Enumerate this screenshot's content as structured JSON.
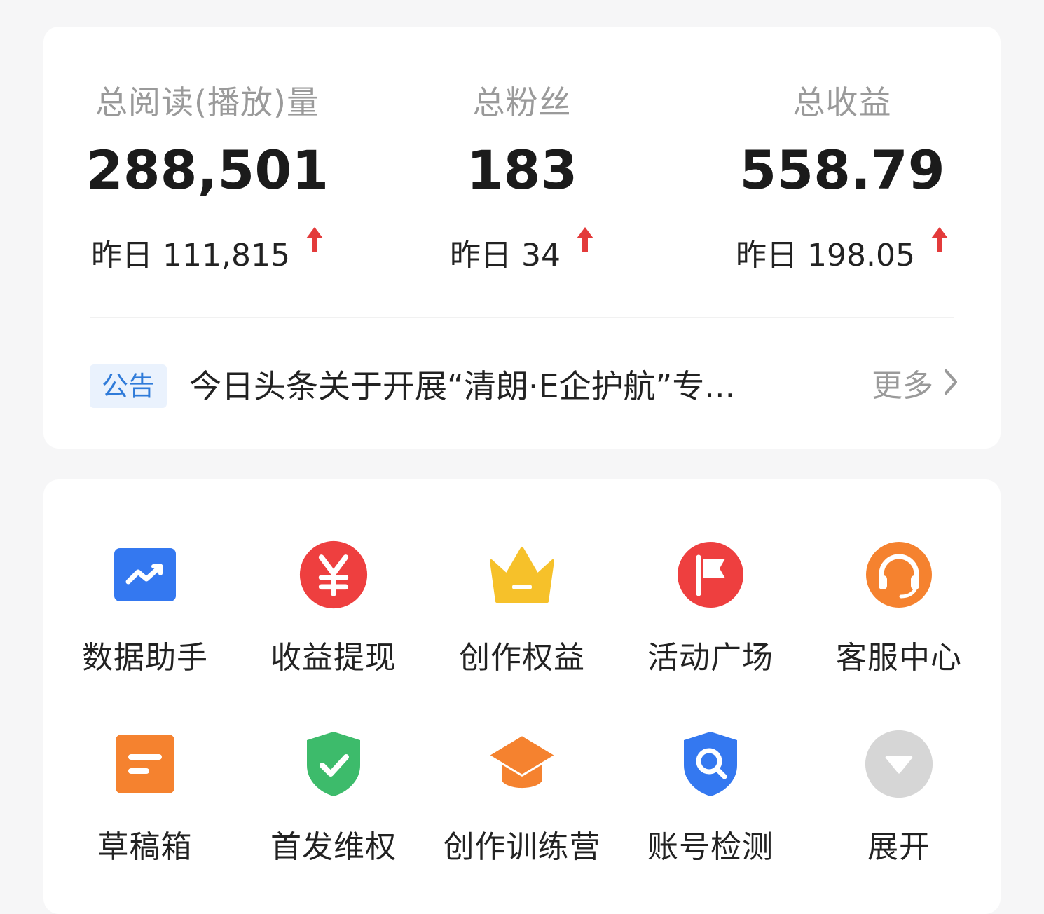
{
  "stats": [
    {
      "label": "总阅读(播放)量",
      "value": "288,501",
      "yesterday": "昨日 111,815"
    },
    {
      "label": "总粉丝",
      "value": "183",
      "yesterday": "昨日 34"
    },
    {
      "label": "总收益",
      "value": "558.79",
      "yesterday": "昨日 198.05"
    }
  ],
  "notice": {
    "badge": "公告",
    "text": "今日头条关于开展“清朗·E企护航”专...",
    "more": "更多"
  },
  "tools": [
    {
      "label": "数据助手",
      "icon": "chart-icon",
      "color": "#3478f0"
    },
    {
      "label": "收益提现",
      "icon": "yuan-icon",
      "color": "#ee3f3f"
    },
    {
      "label": "创作权益",
      "icon": "crown-icon",
      "color": "#f6c12a"
    },
    {
      "label": "活动广场",
      "icon": "flag-icon",
      "color": "#ee3f3f"
    },
    {
      "label": "客服中心",
      "icon": "headset-icon",
      "color": "#f5822f"
    },
    {
      "label": "草稿箱",
      "icon": "draft-icon",
      "color": "#f5822f"
    },
    {
      "label": "首发维权",
      "icon": "shield-check-icon",
      "color": "#3dbb6b"
    },
    {
      "label": "创作训练营",
      "icon": "graduation-cap-icon",
      "color": "#f5822f"
    },
    {
      "label": "账号检测",
      "icon": "search-shield-icon",
      "color": "#3478f0"
    },
    {
      "label": "展开",
      "icon": "expand-icon",
      "color": "#d6d6d6"
    }
  ],
  "colors": {
    "up_arrow": "#e33b3b",
    "badge_text": "#2f7bd9"
  }
}
